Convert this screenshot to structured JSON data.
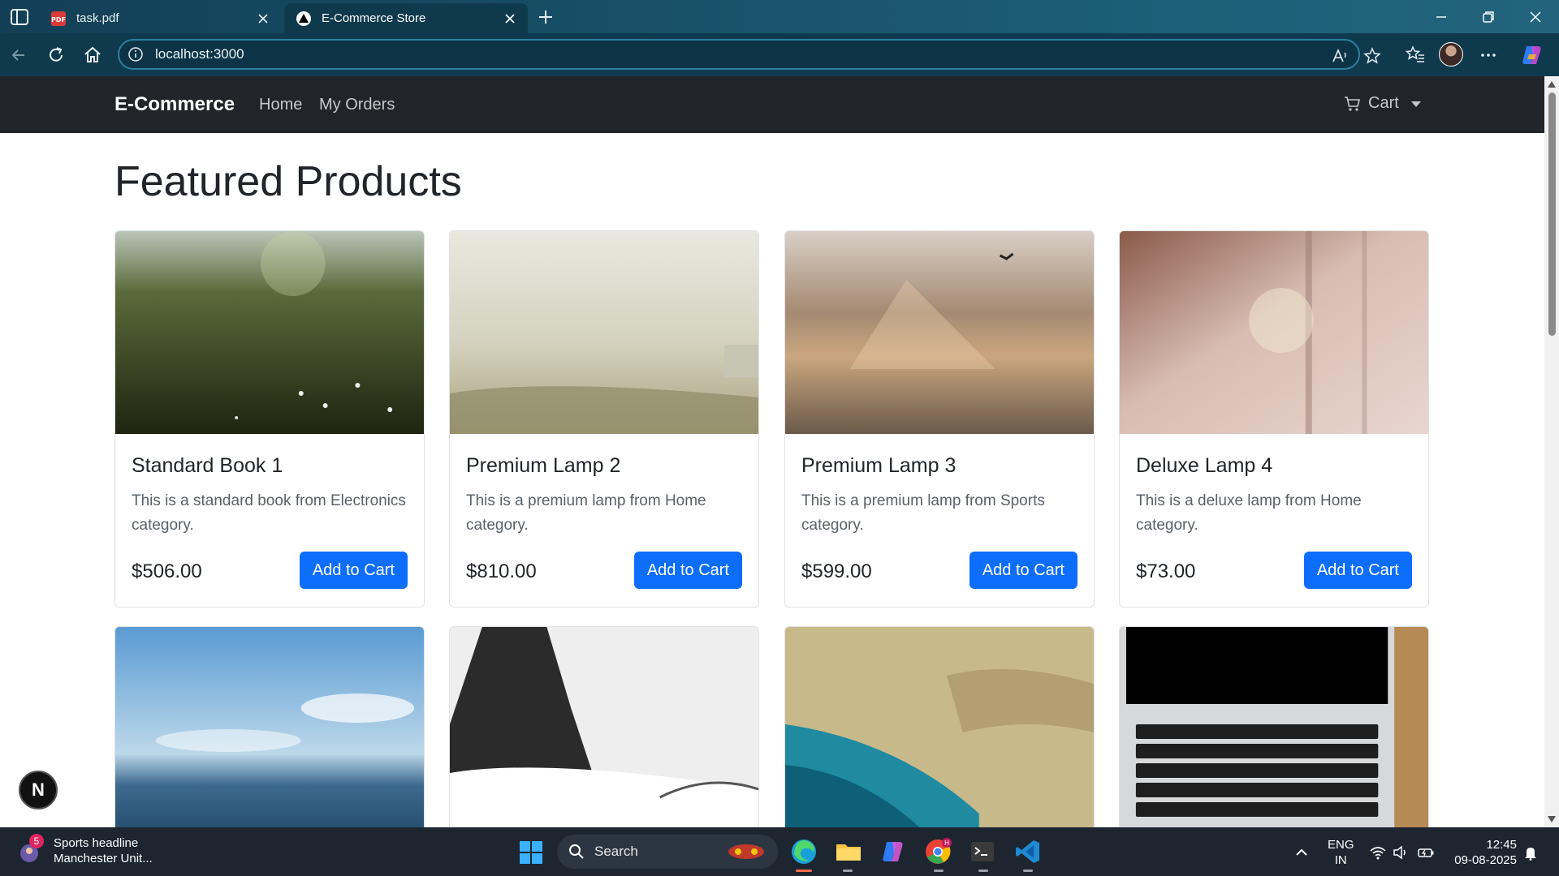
{
  "browser": {
    "tabs": [
      {
        "label": "task.pdf",
        "active": false
      },
      {
        "label": "E-Commerce Store",
        "active": true
      }
    ],
    "url": "localhost:3000"
  },
  "site": {
    "brand": "E-Commerce",
    "nav": [
      "Home",
      "My Orders"
    ],
    "cart_label": "Cart",
    "heading": "Featured Products",
    "add_label": "Add to Cart",
    "products": [
      {
        "name": "Standard Book 1",
        "desc": "This is a standard book from Electronics category.",
        "price": "$506.00"
      },
      {
        "name": "Premium Lamp 2",
        "desc": "This is a premium lamp from Home category.",
        "price": "$810.00"
      },
      {
        "name": "Premium Lamp 3",
        "desc": "This is a premium lamp from Sports category.",
        "price": "$599.00"
      },
      {
        "name": "Deluxe Lamp 4",
        "desc": "This is a deluxe lamp from Home category.",
        "price": "$73.00"
      }
    ],
    "floating_badge": "N",
    "accent": "#0d6efd",
    "navbar_bg": "#212529"
  },
  "taskbar": {
    "news_count": "5",
    "news_title": "Sports headline",
    "news_sub": "Manchester Unit...",
    "search_label": "Search",
    "lang_top": "ENG",
    "lang_bottom": "IN",
    "time": "12:45",
    "date": "09-08-2025"
  }
}
